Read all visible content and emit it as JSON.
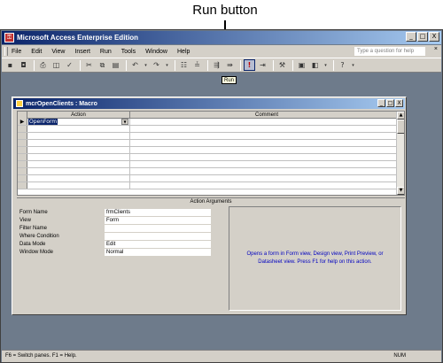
{
  "callout": {
    "label": "Run button"
  },
  "app": {
    "title": "Microsoft Access Enterprise Edition",
    "window_buttons": {
      "minimize": "_",
      "restore": "□",
      "close": "X"
    }
  },
  "menu": {
    "items": [
      "File",
      "Edit",
      "View",
      "Insert",
      "Run",
      "Tools",
      "Window",
      "Help"
    ],
    "help_placeholder": "Type a question for help"
  },
  "toolbar": {
    "tooltip": "Run",
    "buttons": [
      "save-icon",
      "disk-icon",
      "print-icon",
      "preview-icon",
      "spelling-icon",
      "cut-icon",
      "copy-icon",
      "paste-icon",
      "undo-icon",
      "redo-icon",
      "macro-names-icon",
      "conditions-icon",
      "insert-rows-icon",
      "delete-rows-icon",
      "run-icon",
      "step-icon",
      "build-icon",
      "database-window-icon",
      "new-object-icon",
      "help-icon"
    ]
  },
  "macro_window": {
    "title": "mcrOpenClients : Macro",
    "columns": [
      "Action",
      "Comment"
    ],
    "rows": [
      {
        "action": "OpenForm",
        "comment": ""
      },
      {
        "action": "",
        "comment": ""
      },
      {
        "action": "",
        "comment": ""
      },
      {
        "action": "",
        "comment": ""
      },
      {
        "action": "",
        "comment": ""
      },
      {
        "action": "",
        "comment": ""
      },
      {
        "action": "",
        "comment": ""
      },
      {
        "action": "",
        "comment": ""
      },
      {
        "action": "",
        "comment": ""
      },
      {
        "action": "",
        "comment": ""
      }
    ],
    "args_header": "Action Arguments",
    "arguments": [
      {
        "label": "Form Name",
        "value": "frmClients"
      },
      {
        "label": "View",
        "value": "Form"
      },
      {
        "label": "Filter Name",
        "value": ""
      },
      {
        "label": "Where Condition",
        "value": ""
      },
      {
        "label": "Data Mode",
        "value": "Edit"
      },
      {
        "label": "Window Mode",
        "value": "Normal"
      }
    ],
    "hint": "Opens a form in Form view, Design view, Print Preview, or Datasheet view. Press F1 for help on this action."
  },
  "status": {
    "text": "F6 = Switch panes.  F1 = Help.",
    "num": "NUM"
  },
  "colors": {
    "titlebar": "#0a246a",
    "hint_text": "#0000c0",
    "workspace": "#6e7b8b"
  }
}
